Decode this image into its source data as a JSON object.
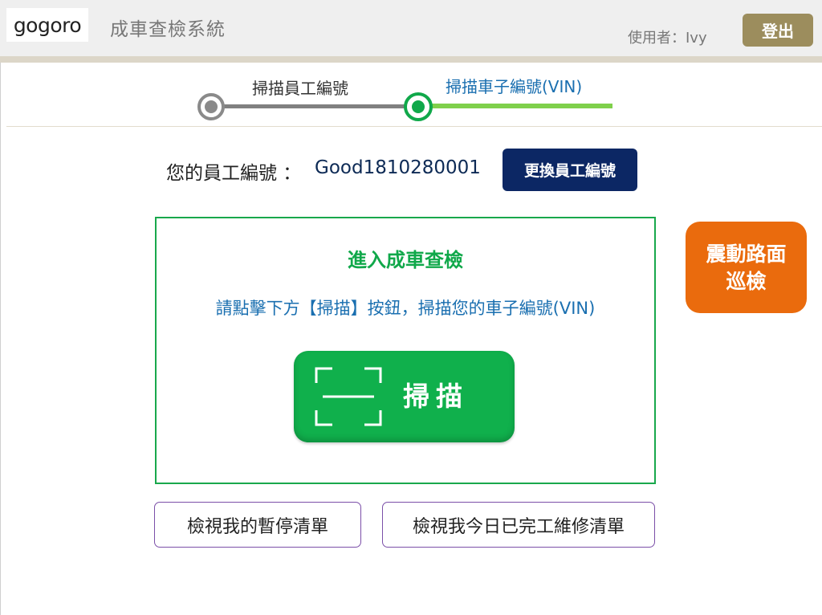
{
  "header": {
    "logo_text": "gogoro",
    "app_title": "成車查檢系統",
    "user_label": "使用者：Ivy",
    "logout_label": "登出"
  },
  "stepper": {
    "steps": [
      {
        "label": "掃描員工編號",
        "state": "done"
      },
      {
        "label": "掃描車子編號(VIN)",
        "state": "active"
      }
    ]
  },
  "employee": {
    "label": "您的員工編號 ：",
    "value": "Good1810280001",
    "change_button": "更換員工編號"
  },
  "scan_panel": {
    "title": "進入成車查檢",
    "instruction": "請點擊下方【掃描】按鈕，掃描您的車子編號(VIN)",
    "scan_button": "掃描",
    "scan_icon": "scan-frame-icon"
  },
  "side_button": {
    "line1": "震動路面",
    "line2": "巡檢"
  },
  "bottom_buttons": {
    "paused_list": "檢視我的暫停清單",
    "completed_list": "檢視我今日已完工維修清單"
  },
  "colors": {
    "brand_gold": "#9c8d5d",
    "primary_navy": "#0c2764",
    "success_green": "#10b04c",
    "accent_orange": "#ea6b0d",
    "link_blue": "#1a6fb0",
    "outline_purple": "#7b4fa8"
  }
}
